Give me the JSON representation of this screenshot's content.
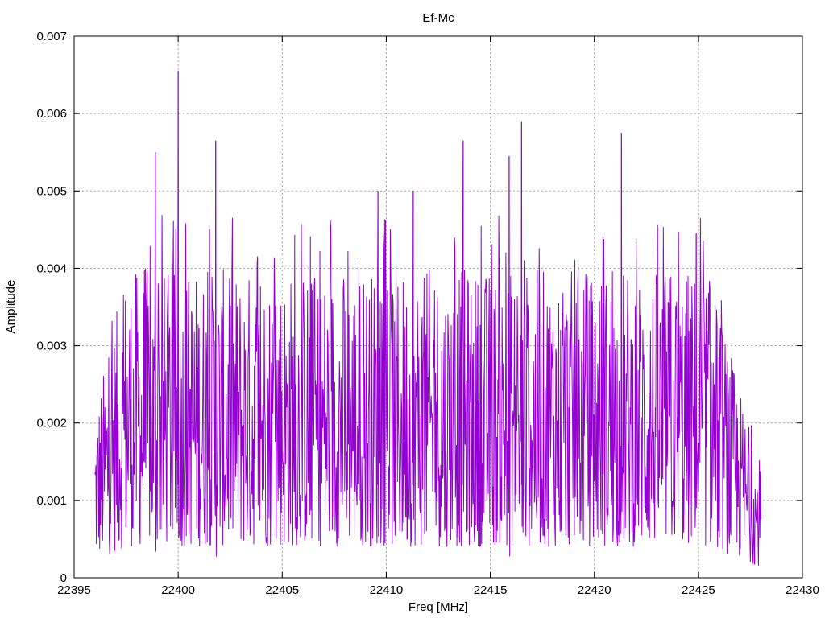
{
  "chart_data": {
    "type": "line",
    "title": "Ef-Mc",
    "xlabel": "Freq [MHz]",
    "ylabel": "Amplitude",
    "xlim": [
      22395,
      22430
    ],
    "ylim": [
      0,
      0.007
    ],
    "xticks": [
      "22395",
      "22400",
      "22405",
      "22410",
      "22415",
      "22420",
      "22425",
      "22430"
    ],
    "yticks": [
      "0",
      "0.001",
      "0.002",
      "0.003",
      "0.004",
      "0.005",
      "0.006",
      "0.007"
    ],
    "grid": true,
    "line_color": "#9400d3",
    "series": [
      {
        "x_range": [
          22396,
          22428
        ],
        "approx_envelope_note": "",
        "peaks": [
          {
            "x": 22398.9,
            "y": 0.0055
          },
          {
            "x": 22400.0,
            "y": 0.00655
          },
          {
            "x": 22401.8,
            "y": 0.00565
          },
          {
            "x": 22409.6,
            "y": 0.005
          },
          {
            "x": 22411.3,
            "y": 0.005
          },
          {
            "x": 22413.7,
            "y": 0.00565
          },
          {
            "x": 22415.9,
            "y": 0.00545
          },
          {
            "x": 22416.5,
            "y": 0.0059
          },
          {
            "x": 22421.3,
            "y": 0.00575
          },
          {
            "x": 22424.9,
            "y": 0.00445
          }
        ]
      }
    ]
  }
}
